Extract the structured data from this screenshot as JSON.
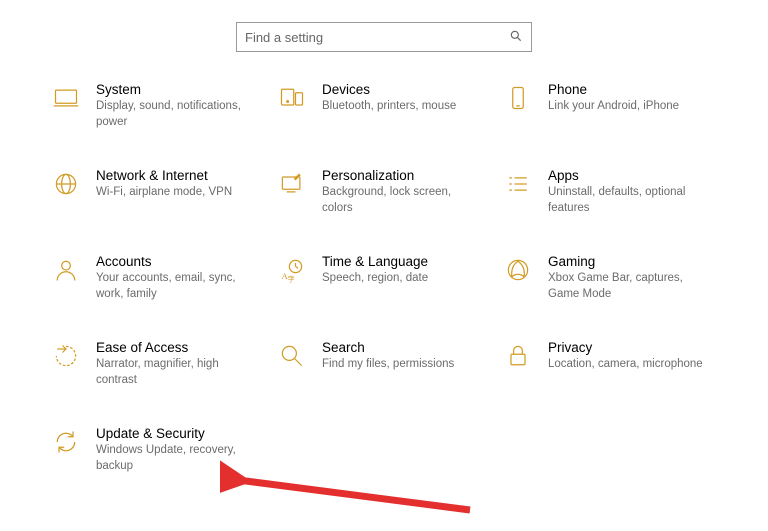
{
  "search": {
    "placeholder": "Find a setting"
  },
  "tiles": [
    {
      "id": "system",
      "title": "System",
      "desc": "Display, sound, notifications, power"
    },
    {
      "id": "devices",
      "title": "Devices",
      "desc": "Bluetooth, printers, mouse"
    },
    {
      "id": "phone",
      "title": "Phone",
      "desc": "Link your Android, iPhone"
    },
    {
      "id": "network",
      "title": "Network & Internet",
      "desc": "Wi-Fi, airplane mode, VPN"
    },
    {
      "id": "personalization",
      "title": "Personalization",
      "desc": "Background, lock screen, colors"
    },
    {
      "id": "apps",
      "title": "Apps",
      "desc": "Uninstall, defaults, optional features"
    },
    {
      "id": "accounts",
      "title": "Accounts",
      "desc": "Your accounts, email, sync, work, family"
    },
    {
      "id": "time",
      "title": "Time & Language",
      "desc": "Speech, region, date"
    },
    {
      "id": "gaming",
      "title": "Gaming",
      "desc": "Xbox Game Bar, captures, Game Mode"
    },
    {
      "id": "ease",
      "title": "Ease of Access",
      "desc": "Narrator, magnifier, high contrast"
    },
    {
      "id": "search",
      "title": "Search",
      "desc": "Find my files, permissions"
    },
    {
      "id": "privacy",
      "title": "Privacy",
      "desc": "Location, camera, microphone"
    },
    {
      "id": "update",
      "title": "Update & Security",
      "desc": "Windows Update, recovery, backup"
    }
  ],
  "colors": {
    "accent": "#d29b24",
    "arrow": "#e3302f"
  }
}
